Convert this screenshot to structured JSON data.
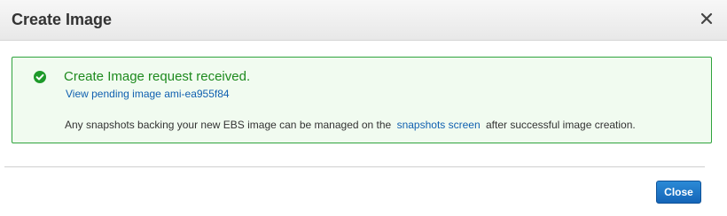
{
  "dialog": {
    "title": "Create Image",
    "close_icon": "close-icon"
  },
  "alert": {
    "status": "success",
    "icon": "check-circle-icon",
    "title": "Create Image request received.",
    "pending_link": "View pending image ami-ea955f84",
    "info_before": "Any snapshots backing your new EBS image can be managed on the",
    "info_link": "snapshots screen",
    "info_after": "after successful image creation."
  },
  "footer": {
    "close_label": "Close"
  },
  "colors": {
    "success_border": "#2fa33d",
    "success_text": "#1e8a1e",
    "link": "#1060b0",
    "primary_button": "#1a73c8"
  }
}
